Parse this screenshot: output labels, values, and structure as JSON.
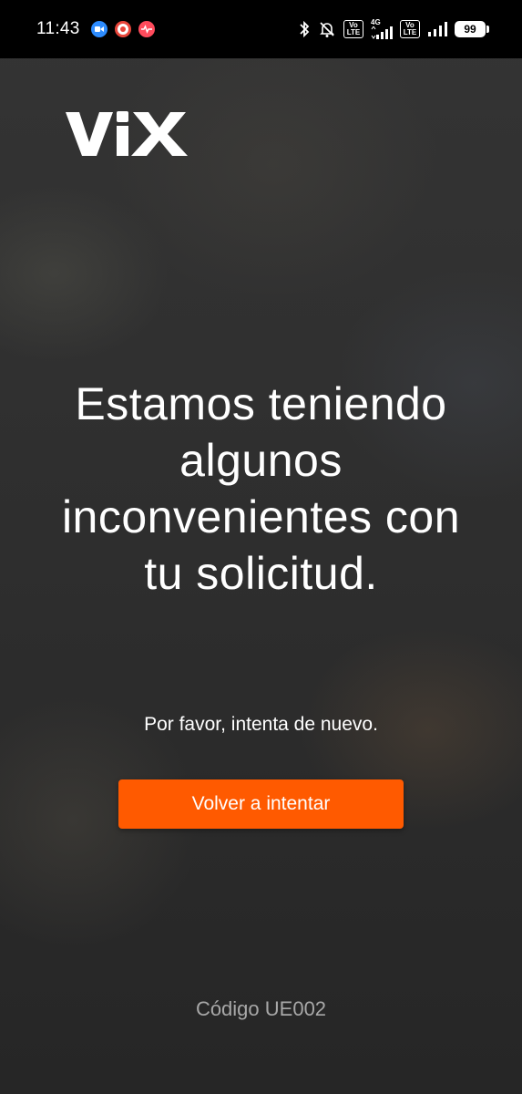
{
  "status_bar": {
    "time": "11:43",
    "network_type": "4G",
    "volte_label_1": "Vo LTE",
    "volte_label_2": "Vo LTE",
    "battery_level": "99"
  },
  "logo": {
    "text": "ViX"
  },
  "error": {
    "headline": "Estamos teniendo algunos inconvenientes con tu solicitud.",
    "message": "Por favor, intenta de nuevo.",
    "retry_label": "Volver a intentar",
    "code": "Código UE002"
  },
  "colors": {
    "accent": "#ff5a00",
    "text_primary": "#ffffff",
    "text_secondary": "#a8a8a8",
    "status_bar_bg": "#000000"
  }
}
